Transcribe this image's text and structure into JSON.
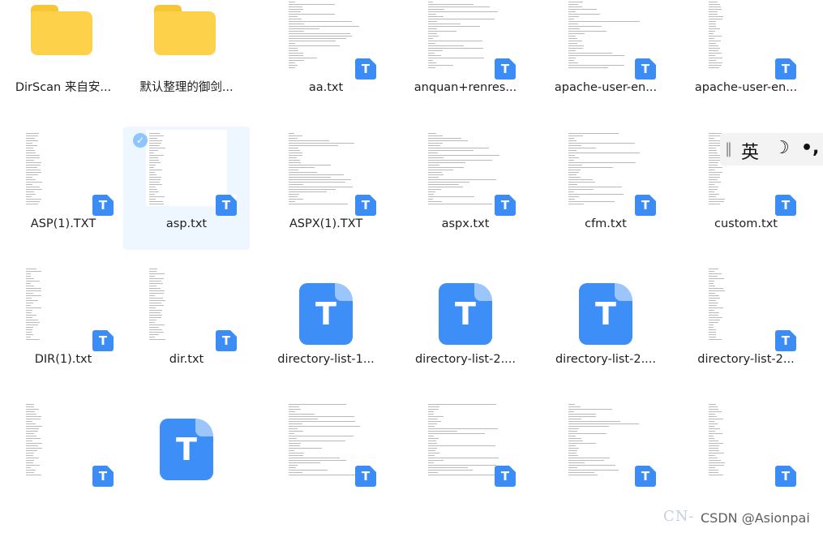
{
  "files": [
    {
      "name": "DirScan 来自安...",
      "kind": "folder"
    },
    {
      "name": "默认整理的御剑...",
      "kind": "folder"
    },
    {
      "name": "aa.txt",
      "kind": "thumb"
    },
    {
      "name": "anquan+renres...",
      "kind": "thumb"
    },
    {
      "name": "apache-user-en...",
      "kind": "thumb"
    },
    {
      "name": "apache-user-en...",
      "kind": "thumb"
    },
    {
      "name": "ASP(1).TXT",
      "kind": "thumb"
    },
    {
      "name": "asp.txt",
      "kind": "thumb",
      "selected": true
    },
    {
      "name": "ASPX(1).TXT",
      "kind": "thumb"
    },
    {
      "name": "aspx.txt",
      "kind": "thumb"
    },
    {
      "name": "cfm.txt",
      "kind": "thumb"
    },
    {
      "name": "custom.txt",
      "kind": "thumb"
    },
    {
      "name": "DIR(1).txt",
      "kind": "thumb"
    },
    {
      "name": "dir.txt",
      "kind": "thumb"
    },
    {
      "name": "directory-list-1...",
      "kind": "big"
    },
    {
      "name": "directory-list-2....",
      "kind": "big"
    },
    {
      "name": "directory-list-2....",
      "kind": "big"
    },
    {
      "name": "directory-list-2...",
      "kind": "thumb"
    },
    {
      "name": "",
      "kind": "thumb"
    },
    {
      "name": "",
      "kind": "big"
    },
    {
      "name": "",
      "kind": "thumb"
    },
    {
      "name": "",
      "kind": "thumb"
    },
    {
      "name": "",
      "kind": "thumb"
    },
    {
      "name": "",
      "kind": "thumb"
    }
  ],
  "file_type_badge": "T",
  "ime": {
    "separator": "‖",
    "lang": "英",
    "mode_icon": "moon-icon",
    "punct": "•,"
  },
  "watermark": {
    "faint": "CN- .",
    "author": "CSDN @Asionpai"
  },
  "colors": {
    "accent": "#3b8cf5",
    "folder": "#fdd14a",
    "selected": "#eef6ff"
  }
}
